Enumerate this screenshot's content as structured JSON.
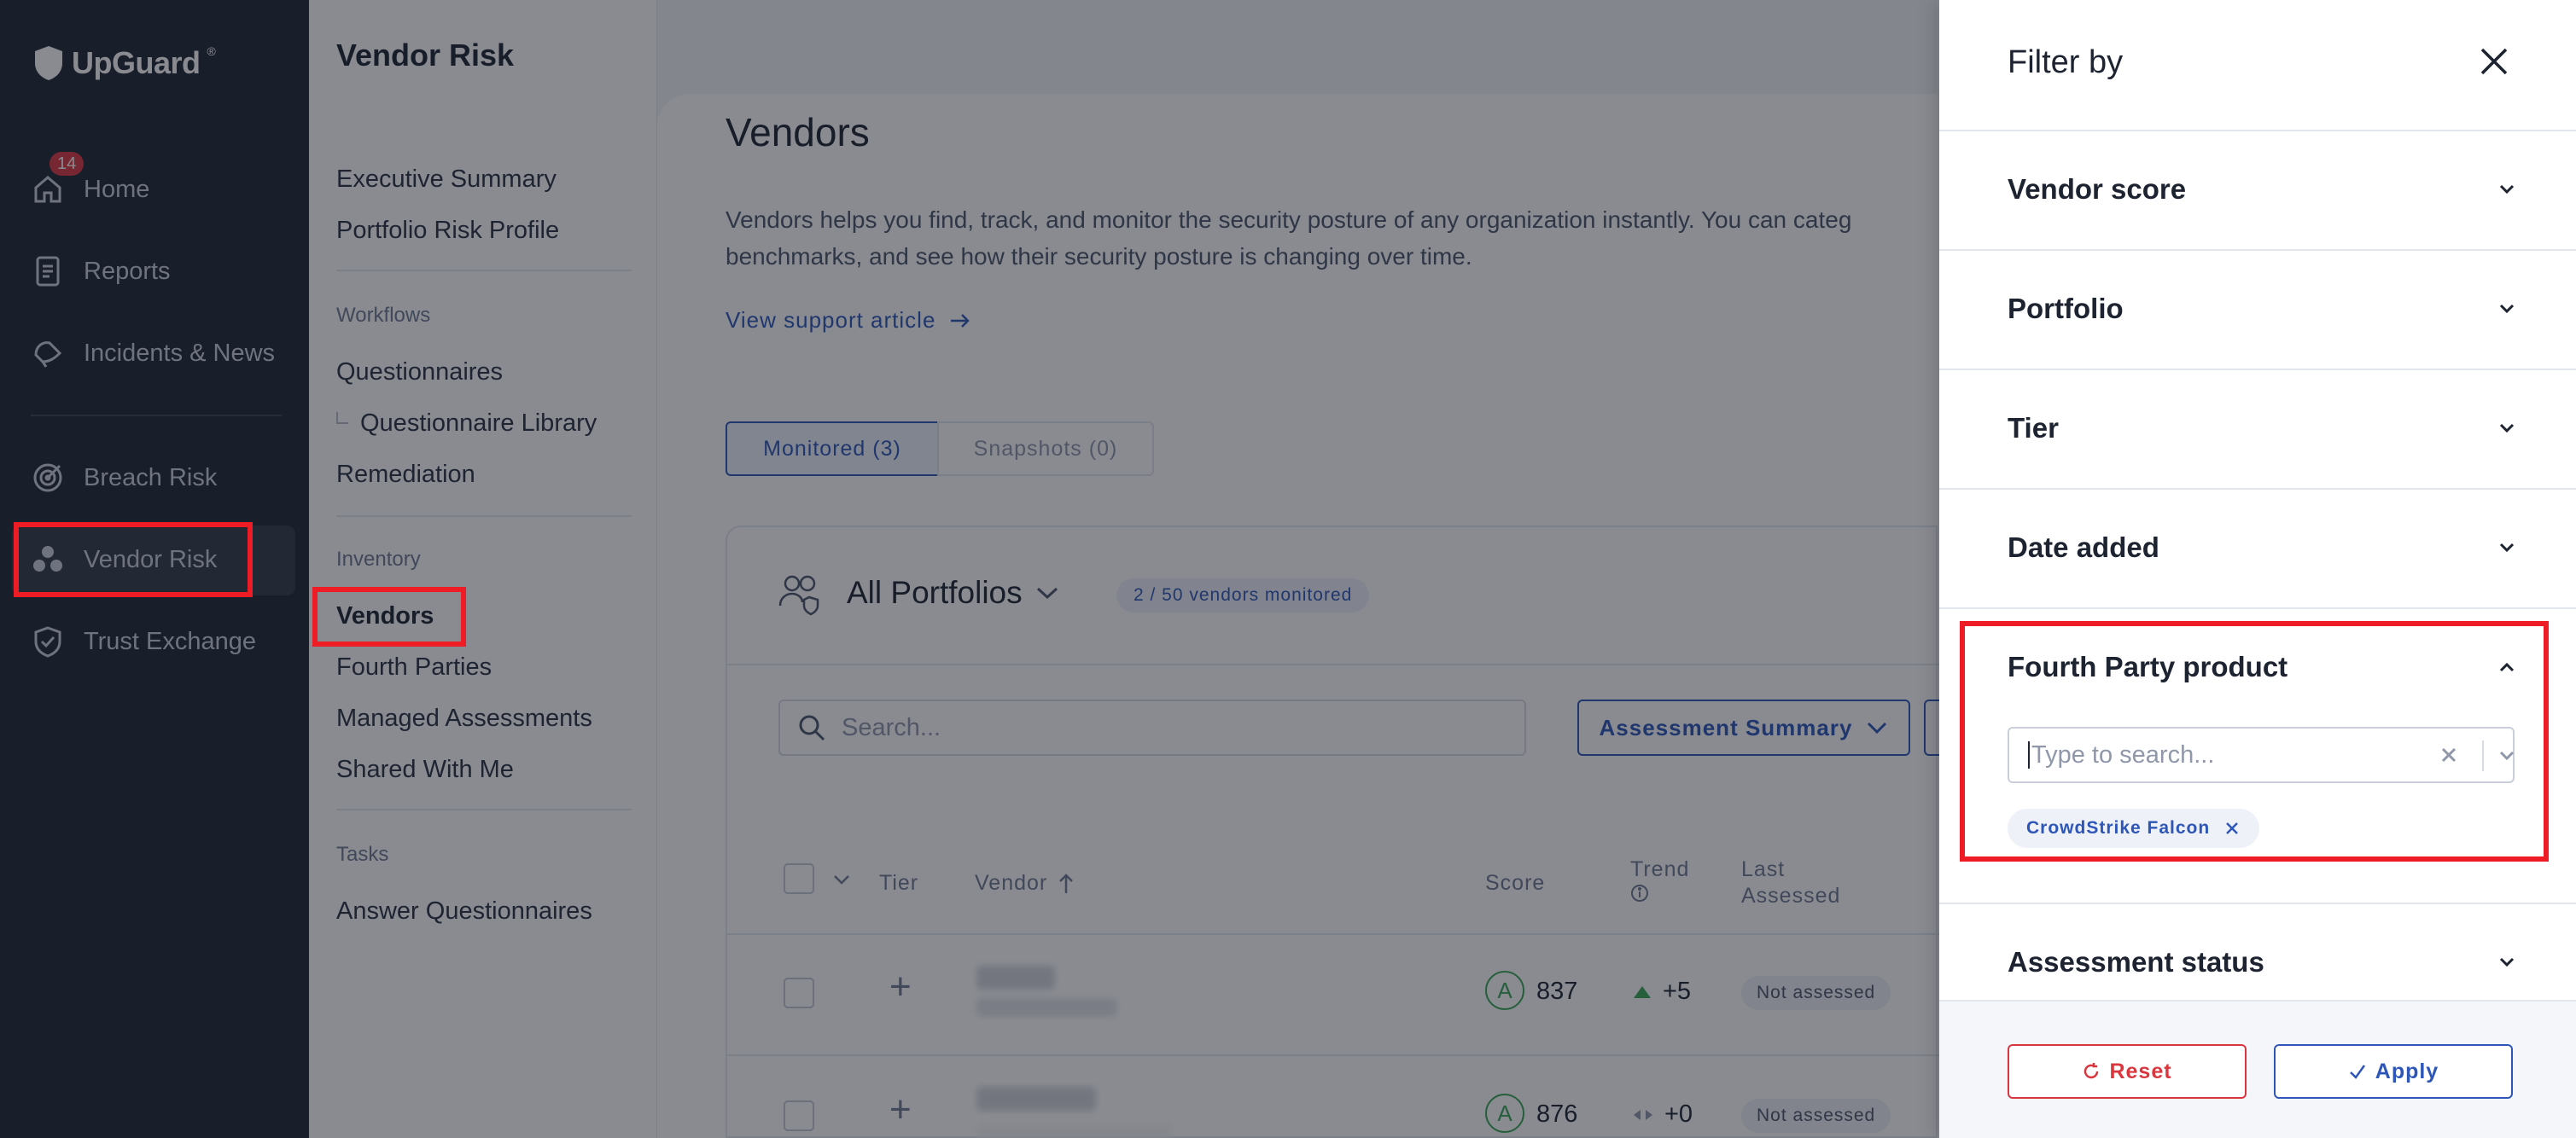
{
  "app": {
    "logo_text": "UpGuard",
    "logo_mark": "®"
  },
  "leftnav": {
    "items": [
      {
        "label": "Home",
        "icon": "home-icon",
        "badge": "14"
      },
      {
        "label": "Reports",
        "icon": "report-icon"
      },
      {
        "label": "Incidents & News",
        "icon": "incidents-icon"
      },
      {
        "label": "Breach Risk",
        "icon": "breach-risk-icon"
      },
      {
        "label": "Vendor Risk",
        "icon": "vendor-risk-icon",
        "active": true
      },
      {
        "label": "Trust Exchange",
        "icon": "trust-exchange-icon"
      }
    ]
  },
  "subnav": {
    "title": "Vendor Risk",
    "items": [
      "Executive Summary",
      "Portfolio Risk Profile"
    ],
    "workflows_head": "Workflows",
    "workflows": [
      "Questionnaires",
      "Questionnaire Library",
      "Remediation"
    ],
    "inventory_head": "Inventory",
    "inventory": [
      "Vendors",
      "Fourth Parties",
      "Managed Assessments",
      "Shared With Me"
    ],
    "tasks_head": "Tasks",
    "tasks": [
      "Answer Questionnaires"
    ]
  },
  "main": {
    "title": "Vendors",
    "description_line1": "Vendors helps you find, track, and monitor the security posture of any organization instantly. You can categ",
    "description_line2": "benchmarks, and see how their security posture is changing over time.",
    "support_link": "View support article",
    "tabs": [
      {
        "label": "Monitored (3)",
        "active": true
      },
      {
        "label": "Snapshots (0)",
        "active": false
      }
    ],
    "portfolio_title": "All Portfolios",
    "vendors_badge": "2 / 50 vendors monitored",
    "search_placeholder": "Search...",
    "assessment_button": "Assessment Summary",
    "columns": [
      "Tier",
      "Vendor",
      "Score",
      "Trend",
      "Last Assessed"
    ],
    "rows": [
      {
        "grade": "A",
        "score": "837",
        "trend": "+5",
        "trend_dir": "up",
        "status": "Not assessed"
      },
      {
        "grade": "A",
        "score": "876",
        "trend": "+0",
        "trend_dir": "flat",
        "status": "Not assessed"
      }
    ]
  },
  "filter": {
    "title": "Filter by",
    "sections": [
      "Vendor score",
      "Portfolio",
      "Tier",
      "Date added",
      "Fourth Party product",
      "Assessment status"
    ],
    "fourth_party_placeholder": "Type to search...",
    "selected_tag": "CrowdStrike Falcon",
    "reset_label": "Reset",
    "apply_label": "Apply"
  },
  "colors": {
    "accent": "#2d56b8",
    "danger": "#d9363e",
    "nav_bg": "#1f2533",
    "highlight": "#ee1c24"
  }
}
